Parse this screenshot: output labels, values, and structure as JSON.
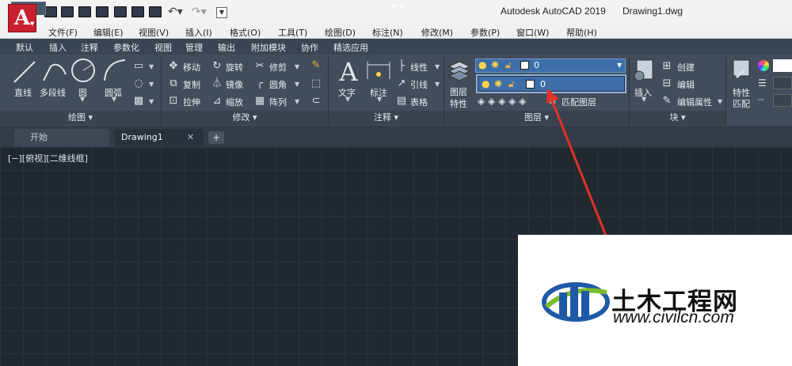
{
  "window": {
    "title": "Autodesk AutoCAD 2019",
    "file": "Drawing1.dwg"
  },
  "app_logo": {
    "letter": "A",
    "icon": "autocad-logo-icon"
  },
  "quick_access": [
    {
      "icon": "new-icon"
    },
    {
      "icon": "open-icon"
    },
    {
      "icon": "save-icon"
    },
    {
      "icon": "save-as-icon"
    },
    {
      "icon": "import-icon"
    },
    {
      "icon": "export-icon"
    },
    {
      "icon": "print-icon"
    },
    {
      "icon": "undo-icon"
    },
    {
      "icon": "redo-icon"
    }
  ],
  "menu": [
    "文件(F)",
    "编辑(E)",
    "视图(V)",
    "插入(I)",
    "格式(O)",
    "工具(T)",
    "绘图(D)",
    "标注(N)",
    "修改(M)",
    "参数(P)",
    "窗口(W)",
    "帮助(H)"
  ],
  "ribbon_tabs": [
    "默认",
    "插入",
    "注释",
    "参数化",
    "视图",
    "管理",
    "输出",
    "附加模块",
    "协作",
    "精选应用"
  ],
  "draw_panel": {
    "line": "直线",
    "polyline": "多段线",
    "circle": "圆",
    "arc": "圆弧",
    "footer": "绘图"
  },
  "modify_panel": {
    "move": "移动",
    "rotate": "旋转",
    "trim": "修剪",
    "copy": "复制",
    "mirror": "镜像",
    "fillet": "圆角",
    "stretch": "拉伸",
    "scale": "缩放",
    "array": "阵列",
    "footer": "修改"
  },
  "annotation_panel": {
    "text": "文字",
    "dimension": "标注",
    "linetype": "线性",
    "leader": "引线",
    "table": "表格",
    "footer": "注释"
  },
  "layers_panel": {
    "layer_properties_line1": "图层",
    "layer_properties_line2": "特性",
    "current_layer": "0",
    "dropdown_layer": "0",
    "match_layer": "匹配图层",
    "footer": "图层"
  },
  "block_panel": {
    "insert": "插入",
    "create": "创建",
    "edit": "编辑",
    "edit_attributes": "编辑属性",
    "footer": "块"
  },
  "properties_panel": {
    "match_line1": "特性",
    "match_line2": "匹配"
  },
  "doc_tabs": {
    "start": "开始",
    "drawing": "Drawing1"
  },
  "viewport_label": "[−][俯视][二维线框]",
  "watermark": {
    "name": "土木工程网",
    "url": "www.civilcn.com"
  },
  "colors": {
    "accent": "#3d6ea8",
    "arrow": "#e0322a",
    "logo": "#c8202e"
  }
}
